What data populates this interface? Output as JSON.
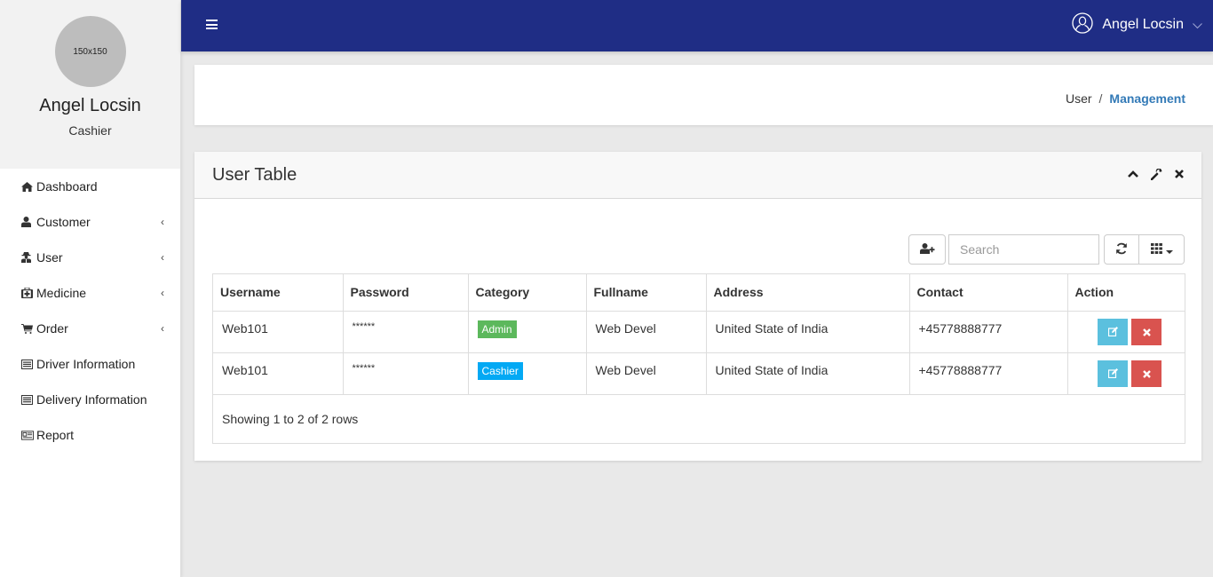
{
  "sidebar": {
    "avatar_text": "150x150",
    "name": "Angel Locsin",
    "role": "Cashier",
    "items": [
      {
        "label": "Dashboard",
        "icon": "home-icon",
        "has_submenu": false
      },
      {
        "label": "Customer",
        "icon": "user-icon",
        "has_submenu": true
      },
      {
        "label": "User",
        "icon": "user-secret-icon",
        "has_submenu": true
      },
      {
        "label": "Medicine",
        "icon": "medkit-icon",
        "has_submenu": true
      },
      {
        "label": "Order",
        "icon": "cart-icon",
        "has_submenu": true
      },
      {
        "label": "Driver Information",
        "icon": "list-alt-icon",
        "has_submenu": false
      },
      {
        "label": "Delivery Information",
        "icon": "list-alt-icon",
        "has_submenu": false
      },
      {
        "label": "Report",
        "icon": "newspaper-icon",
        "has_submenu": false
      }
    ],
    "chevron": "‹"
  },
  "topbar": {
    "user_name": "Angel Locsin",
    "color": "#1f2d85"
  },
  "breadcrumb": {
    "items": [
      "User",
      "Management"
    ],
    "separator": "/"
  },
  "panel": {
    "title": "User Table",
    "search_placeholder": "Search",
    "columns": [
      "Username",
      "Password",
      "Category",
      "Fullname",
      "Address",
      "Contact",
      "Action"
    ],
    "rows": [
      {
        "username": "Web101",
        "password": "******",
        "category": "Admin",
        "category_color": "#5cb85c",
        "fullname": "Web Devel",
        "address": "United State of India",
        "contact": "+45778888777"
      },
      {
        "username": "Web101",
        "password": "******",
        "category": "Cashier",
        "category_color": "#03a9f4",
        "fullname": "Web Devel",
        "address": "United State of India",
        "contact": "+45778888777"
      }
    ],
    "footer": "Showing 1 to 2 of 2 rows"
  },
  "colors": {
    "edit": "#5bc0de",
    "delete": "#d9534f",
    "link": "#337ab7"
  }
}
